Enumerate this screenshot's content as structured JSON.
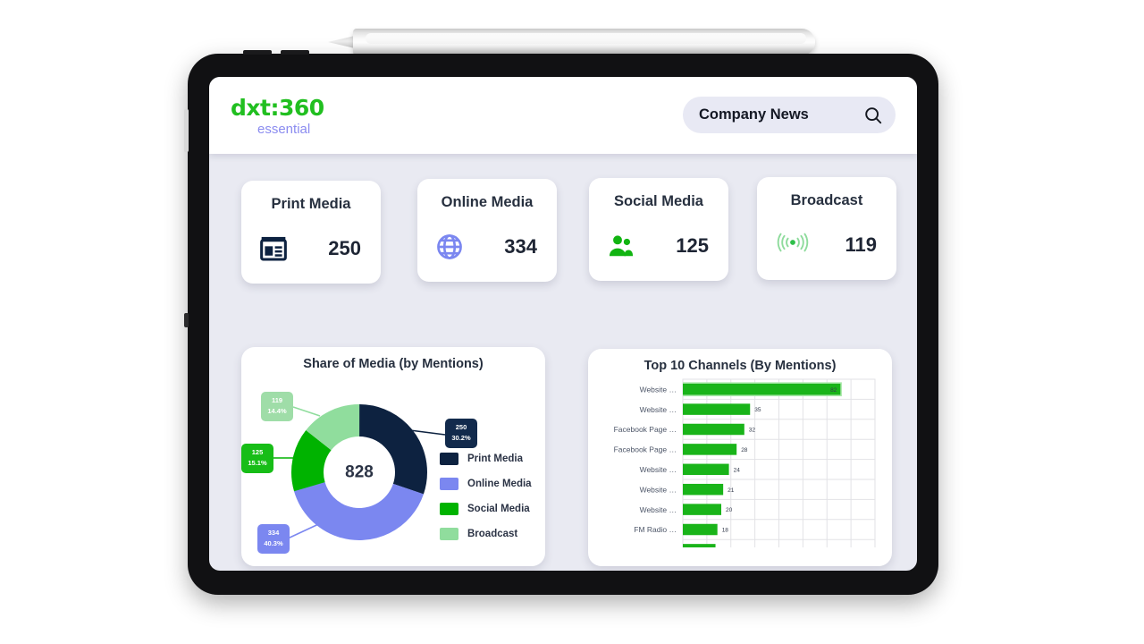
{
  "device": {
    "type": "tablet",
    "accessory": "stylus-pen"
  },
  "header": {
    "logo_main": "dxt:360",
    "logo_sub": "essential",
    "search_value": "Company News",
    "search_icon": "search-icon"
  },
  "kpis": [
    {
      "title": "Print Media",
      "value": "250",
      "icon": "newspaper-icon",
      "color": "#0d2240"
    },
    {
      "title": "Online Media",
      "value": "334",
      "icon": "globe-icon",
      "color": "#7b87f0"
    },
    {
      "title": "Social Media",
      "value": "125",
      "icon": "people-icon",
      "color": "#11b411"
    },
    {
      "title": "Broadcast",
      "value": "119",
      "icon": "broadcast-icon",
      "color": "#8edb9c"
    }
  ],
  "chart_data": [
    {
      "type": "pie",
      "title": "Share of Media (by Mentions)",
      "center_total": "828",
      "legend_position": "right",
      "categories": [
        "Print Media",
        "Online Media",
        "Social Media",
        "Broadcast"
      ],
      "values": [
        250,
        334,
        125,
        119
      ],
      "percents": [
        "30.2%",
        "40.3%",
        "15.1%",
        "14.4%"
      ],
      "colors": [
        "#0d2240",
        "#7b87f0",
        "#00b300",
        "#90dd9d"
      ],
      "labels": [
        {
          "value": "250",
          "percent": "30.2%",
          "color": "#0d2240",
          "text_color": "#ffffff"
        },
        {
          "value": "334",
          "percent": "40.3%",
          "color": "#7b87f0",
          "text_color": "#ffffff"
        },
        {
          "value": "125",
          "percent": "15.1%",
          "color": "#00b300",
          "text_color": "#ffffff"
        },
        {
          "value": "119",
          "percent": "14.4%",
          "color": "#90dd9d",
          "text_color": "#ffffff"
        }
      ]
    },
    {
      "type": "bar",
      "orientation": "horizontal",
      "title": "Top 10 Channels (By Mentions)",
      "xlabel": "",
      "ylabel": "",
      "grid": true,
      "xlim": [
        0,
        100
      ],
      "bar_color": "#19b419",
      "categories": [
        "Website …",
        "Website …",
        "Facebook Page …",
        "Facebook Page …",
        "Website …",
        "Website …",
        "Website …",
        "FM Radio …",
        ""
      ],
      "values": [
        82,
        35,
        32,
        28,
        24,
        21,
        20,
        18,
        17
      ],
      "value_labels": [
        "82",
        "35",
        "32",
        "28",
        "24",
        "21",
        "20",
        "18",
        ""
      ]
    }
  ]
}
